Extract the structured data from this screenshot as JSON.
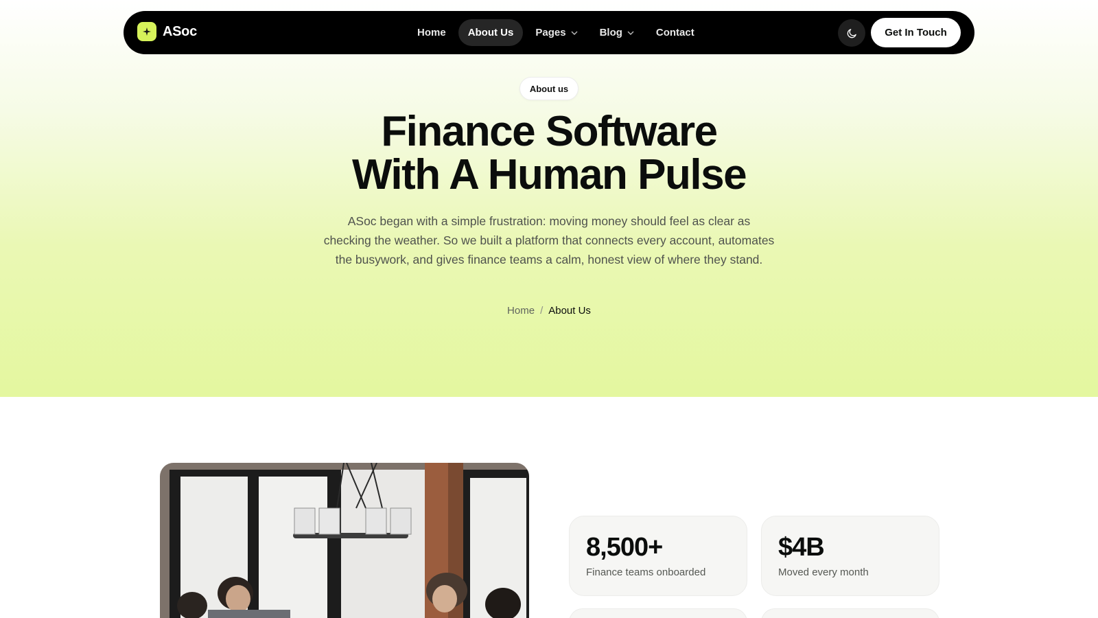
{
  "brand": {
    "name": "ASoc",
    "accent": "#d6f25a"
  },
  "nav": {
    "items": [
      {
        "label": "Home",
        "active": false,
        "dropdown": false
      },
      {
        "label": "About Us",
        "active": true,
        "dropdown": false
      },
      {
        "label": "Pages",
        "active": false,
        "dropdown": true
      },
      {
        "label": "Blog",
        "active": false,
        "dropdown": true
      },
      {
        "label": "Contact",
        "active": false,
        "dropdown": false
      }
    ],
    "theme_icon": "moon-icon",
    "cta_label": "Get In Touch"
  },
  "hero": {
    "badge": "About us",
    "title_line1": "Finance Software",
    "title_line2": "With A Human Pulse",
    "description": "ASoc began with a simple frustration: moving money should feel as clear as checking the weather. So we built a platform that connects every account, automates the busywork, and gives finance teams a calm, honest view of where they stand.",
    "breadcrumb": {
      "home": "Home",
      "separator": "/",
      "current": "About Us"
    }
  },
  "stats": [
    {
      "value": "8,500+",
      "label": "Finance teams onboarded"
    },
    {
      "value": "$4B",
      "label": "Moved every month"
    }
  ]
}
